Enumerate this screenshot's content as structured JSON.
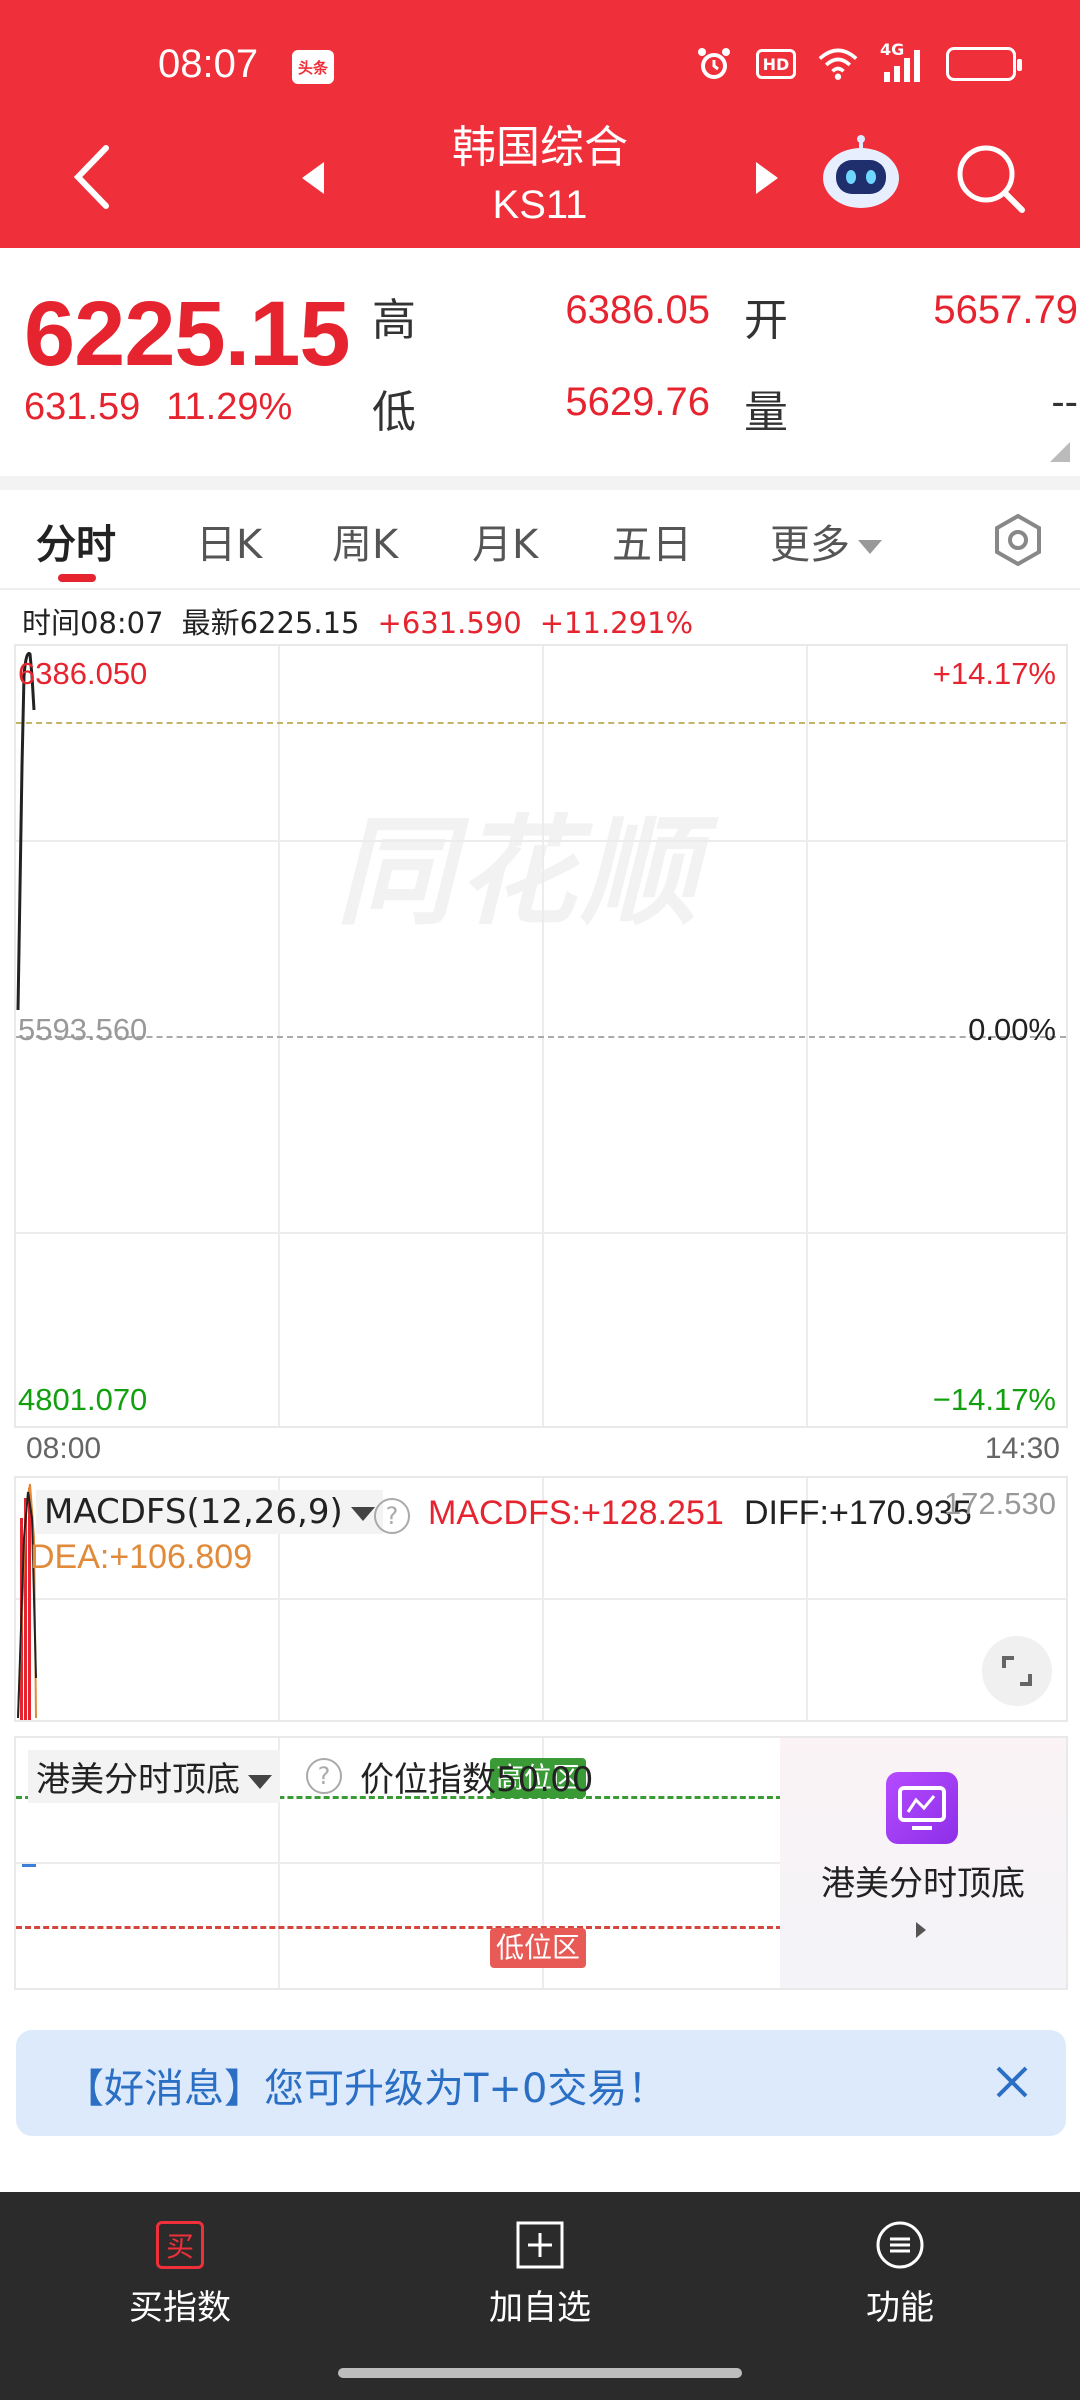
{
  "status_bar": {
    "time": "08:07",
    "app_badge": "头条",
    "hd": "HD",
    "network": "4G"
  },
  "header": {
    "title": "韩国综合",
    "code": "KS11"
  },
  "quote": {
    "price": "6225.15",
    "change": "631.59",
    "change_pct": "11.29%",
    "high_label": "高",
    "high": "6386.05",
    "low_label": "低",
    "low": "5629.76",
    "open_label": "开",
    "open": "5657.79",
    "volume_label": "量",
    "volume": "--"
  },
  "tabs": [
    {
      "label": "分时",
      "active": true
    },
    {
      "label": "日K"
    },
    {
      "label": "周K"
    },
    {
      "label": "月K"
    },
    {
      "label": "五日"
    },
    {
      "label": "更多"
    }
  ],
  "info_line": {
    "time": "时间08:07",
    "latest": "最新6225.15",
    "change": "+631.590",
    "change_pct": "+11.291%"
  },
  "chart": {
    "watermark": "同花顺",
    "top_price": "6386.050",
    "mid_price": "5593.560",
    "bottom_price": "4801.070",
    "top_pct": "+14.17%",
    "mid_pct": "0.00%",
    "bottom_pct": "−14.17%",
    "time_start": "08:00",
    "time_end": "14:30",
    "colors": {
      "up": "#e6242f",
      "down": "#12a00f",
      "line": "#222222"
    }
  },
  "macd": {
    "selector": "MACDFS(12,26,9)",
    "macdfs": "MACDFS:+128.251",
    "diff": "DIFF:+170.935",
    "scale": "172.530",
    "dea": "DEA:+106.809"
  },
  "top_bottom": {
    "selector": "港美分时顶底",
    "index_text": "价位指数50.00",
    "high_zone": "高位区",
    "low_zone": "低位区",
    "promo": "港美分时顶底"
  },
  "notice": {
    "text": "【好消息】您可升级为T+0交易！"
  },
  "bottom_bar": {
    "buy_icon": "买",
    "buy": "买指数",
    "add": "加自选",
    "func": "功能"
  }
}
